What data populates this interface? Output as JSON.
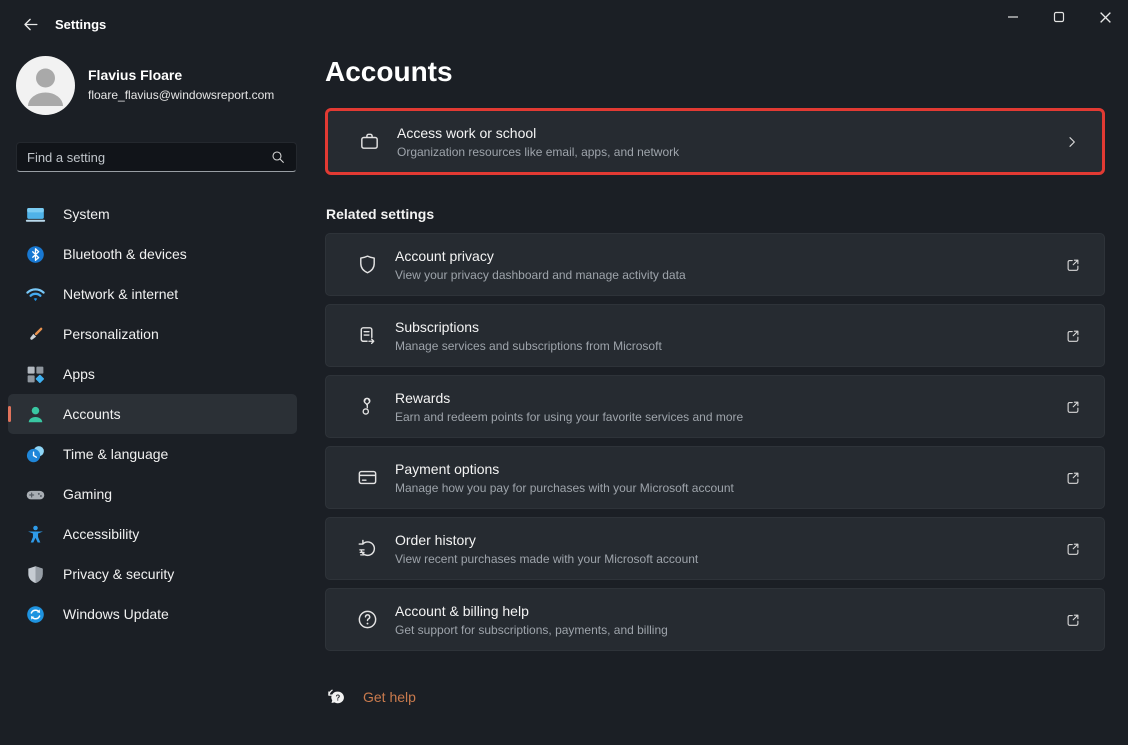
{
  "window": {
    "app_title": "Settings"
  },
  "profile": {
    "name": "Flavius Floare",
    "email": "floare_flavius@windowsreport.com"
  },
  "search": {
    "placeholder": "Find a setting"
  },
  "sidebar": {
    "items": [
      {
        "label": "System",
        "icon": "system-icon"
      },
      {
        "label": "Bluetooth & devices",
        "icon": "bluetooth-icon"
      },
      {
        "label": "Network & internet",
        "icon": "network-icon"
      },
      {
        "label": "Personalization",
        "icon": "personalization-icon"
      },
      {
        "label": "Apps",
        "icon": "apps-icon"
      },
      {
        "label": "Accounts",
        "icon": "accounts-icon",
        "selected": true
      },
      {
        "label": "Time & language",
        "icon": "time-language-icon"
      },
      {
        "label": "Gaming",
        "icon": "gaming-icon"
      },
      {
        "label": "Accessibility",
        "icon": "accessibility-icon"
      },
      {
        "label": "Privacy & security",
        "icon": "privacy-security-icon"
      },
      {
        "label": "Windows Update",
        "icon": "windows-update-icon"
      }
    ]
  },
  "main": {
    "title": "Accounts",
    "access_row": {
      "title": "Access work or school",
      "subtitle": "Organization resources like email, apps, and network",
      "icon": "briefcase-icon",
      "highlighted": true,
      "highlight_color": "#e23a33"
    },
    "related": {
      "heading": "Related settings",
      "rows": [
        {
          "title": "Account privacy",
          "subtitle": "View your privacy dashboard and manage activity data",
          "icon": "shield-icon"
        },
        {
          "title": "Subscriptions",
          "subtitle": "Manage services and subscriptions from Microsoft",
          "icon": "subscriptions-icon"
        },
        {
          "title": "Rewards",
          "subtitle": "Earn and redeem points for using your favorite services and more",
          "icon": "rewards-icon"
        },
        {
          "title": "Payment options",
          "subtitle": "Manage how you pay for purchases with your Microsoft account",
          "icon": "payment-card-icon"
        },
        {
          "title": "Order history",
          "subtitle": "View recent purchases made with your Microsoft account",
          "icon": "order-history-icon"
        },
        {
          "title": "Account & billing help",
          "subtitle": "Get support for subscriptions, payments, and billing",
          "icon": "help-circle-icon"
        }
      ]
    },
    "get_help": {
      "label": "Get help",
      "icon": "get-help-chat-icon"
    }
  },
  "colors": {
    "background": "#1b1f25",
    "card": "#262b31",
    "selected_item": "#2b3036",
    "accent_pill": "#e0735c",
    "highlight_border": "#e23a33",
    "link": "#c97a4d",
    "text_primary": "#f4f4f4",
    "text_secondary": "#9ea4ab"
  }
}
